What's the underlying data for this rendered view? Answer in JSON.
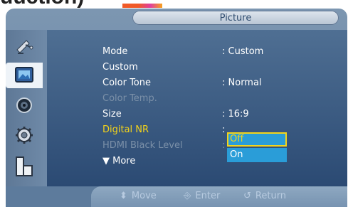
{
  "window": {
    "title": "Picture"
  },
  "sidebar": {
    "tabs": [
      {
        "icon": "satellite-dish-icon"
      },
      {
        "icon": "picture-icon"
      },
      {
        "icon": "speaker-icon"
      },
      {
        "icon": "gear-icon"
      },
      {
        "icon": "input-icon"
      }
    ]
  },
  "menu": {
    "items": [
      {
        "label": "Mode",
        "value": ": Custom"
      },
      {
        "label": "Custom",
        "value": ""
      },
      {
        "label": "Color Tone",
        "value": ": Normal"
      },
      {
        "label": "Color Temp.",
        "value": ""
      },
      {
        "label": "Size",
        "value": ": 16:9"
      },
      {
        "label": "Digital NR",
        "value": ":"
      },
      {
        "label": "HDMI Black Level",
        "value": ":"
      },
      {
        "label": "▼ More",
        "value": ""
      }
    ]
  },
  "dropdown": {
    "options": [
      "Off",
      "On"
    ]
  },
  "footer": {
    "move": "Move",
    "enter": "Enter",
    "return": "Return"
  },
  "top_crop": {
    "text": "uuction)"
  }
}
